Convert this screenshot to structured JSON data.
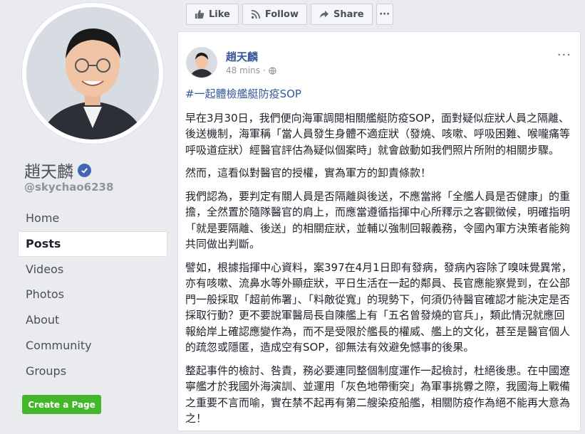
{
  "page": {
    "name": "趙天麟",
    "handle": "@skychao6238",
    "verified": true
  },
  "nav": {
    "items": [
      {
        "label": "Home",
        "active": false
      },
      {
        "label": "Posts",
        "active": true
      },
      {
        "label": "Videos",
        "active": false
      },
      {
        "label": "Photos",
        "active": false
      },
      {
        "label": "About",
        "active": false
      },
      {
        "label": "Community",
        "active": false
      },
      {
        "label": "Groups",
        "active": false
      }
    ],
    "create_page_label": "Create a Page"
  },
  "actions": {
    "like_label": "Like",
    "follow_label": "Follow",
    "share_label": "Share",
    "more_label": "···"
  },
  "post": {
    "author": "趙天麟",
    "time": "48 mins",
    "privacy_icon": "globe-icon",
    "more_label": "···",
    "hashtag": "#一起體檢艦艇防疫SOP",
    "paragraphs": [
      "早在3月30日，我們便向海軍調閱相關艦艇防疫SOP，面對疑似症狀人員之隔離、後送機制，海軍稱「當人員發生身體不適症狀（發燒、咳嗽、呼吸困難、喉嚨痛等呼吸道症狀）經醫官評估為疑似個案時」就會啟動如我們照片所附的相關步驟。",
      "然而，這看似對醫官的授權，實為軍方的卸責條款！",
      "我們認為，要判定有關人員是否隔離與後送，不應當將「全艦人員是否健康」的重擔，全然置於隨隊醫官的肩上，而應當遵循指揮中心所釋示之客觀徵候，明確指明「就是要隔離、後送」的相關症狀，並輔以強制回報義務，令國內軍方決策者能夠共同做出判斷。",
      "譬如，根據指揮中心資料，案397在4月1日即有發病，發病內容除了嗅味覺異常，亦有咳嗽、流鼻水等外顯症狀，平日生活在一起的鄰員、長官應能察覺到，在公部門一般採取「超前佈署」、「料敵從寬」的現勢下，何須仍待醫官確認才能決定是否採取行動？更不要說軍醫局長自陳艦上有「五名曾發燒的官兵」，類此情況就應回報給岸上確認應變作為，而不是受限於艦長的權威、艦上的文化，甚至是醫官個人的疏忽或隱匿，造成空有SOP，卻無法有效避免憾事的後果。",
      "整起事件的檢討、咎責，務必要連同整個制度運作一起檢討，杜絕後患。在中國遼寧艦才於我國外海演訓、並運用「灰色地帶衝突」為軍事挑釁之際，我國海上戰備之重要不言而喻，實在禁不起再有第二艘染疫船艦，相關防疫作為絕不能再大意為之！"
    ]
  },
  "colors": {
    "background": "#e9ebee",
    "link": "#365899",
    "verified": "#4267b2",
    "create_button": "#42b72a"
  }
}
